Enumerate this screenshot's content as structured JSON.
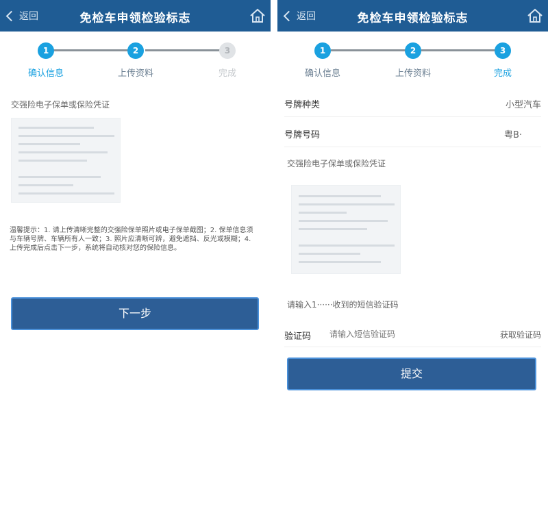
{
  "colors": {
    "nav": "#1f5c94",
    "accent": "#1aa1e0",
    "button": "#2d5e96",
    "button_border": "#4a90d9"
  },
  "left": {
    "nav": {
      "back_label": "返回",
      "title": "免检车申领检验标志",
      "home_icon": "home-icon"
    },
    "steps": [
      {
        "number": "1",
        "label": "确认信息"
      },
      {
        "number": "2",
        "label": "上传资料"
      },
      {
        "number": "3",
        "label": "完成"
      }
    ],
    "upload_label": "交强险电子保单或保险凭证",
    "notice": "温馨提示：1. 请上传清晰完整的交强险保单照片或电子保单截图；2. 保单信息须与车辆号牌、车辆所有人一致；3. 照片应清晰可辨，避免遮挡、反光或模糊；4. 上传完成后点击下一步，系统将自动核对您的保险信息。",
    "next_label": "下一步"
  },
  "right": {
    "nav": {
      "back_label": "返回",
      "title": "免检车申领检验标志",
      "home_icon": "home-icon"
    },
    "steps": [
      {
        "number": "1",
        "label": "确认信息"
      },
      {
        "number": "2",
        "label": "上传资料"
      },
      {
        "number": "3",
        "label": "完成"
      }
    ],
    "plate_type_label": "号牌种类",
    "plate_type_value": "小型汽车",
    "plate_number_label": "号牌号码",
    "plate_number_value": "粤B·",
    "upload_label": "交强险电子保单或保险凭证",
    "sms_notice": "请输入1······收到的短信验证码",
    "captcha_label": "验证码",
    "captcha_placeholder": "请输入短信验证码",
    "captcha_button": "获取验证码",
    "submit_label": "提交"
  }
}
